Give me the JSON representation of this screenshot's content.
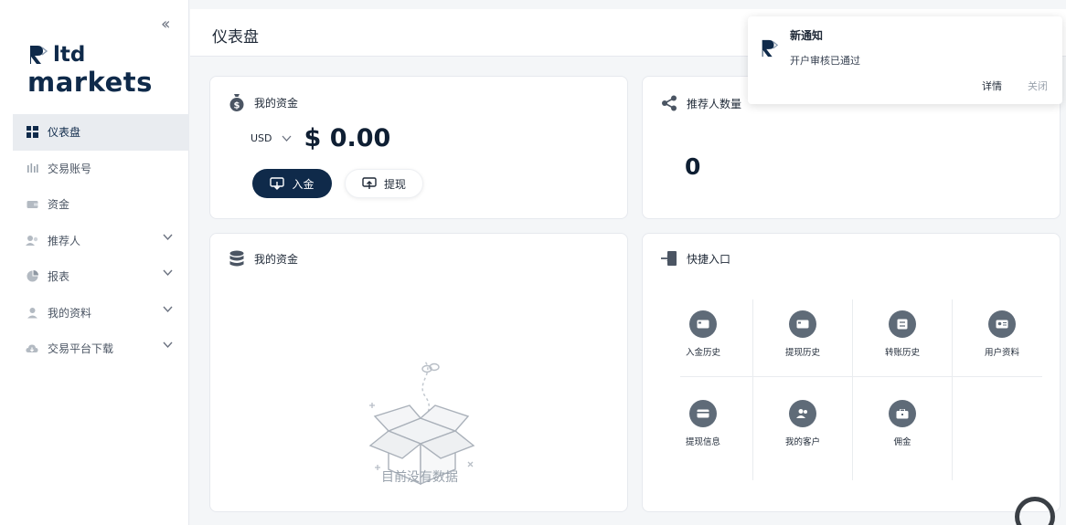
{
  "app": {
    "logo_line1": "ltd",
    "logo_line2": "markets",
    "brand_color": "#0f2a4a"
  },
  "sidebar": {
    "collapse_icon": "double-chevron-left-icon",
    "items": [
      {
        "label": "仪表盘",
        "icon": "dashboard-grid-icon",
        "active": true,
        "has_submenu": false
      },
      {
        "label": "交易账号",
        "icon": "trading-account-icon",
        "active": false,
        "has_submenu": false
      },
      {
        "label": "资金",
        "icon": "wallet-icon",
        "active": false,
        "has_submenu": false
      },
      {
        "label": "推荐人",
        "icon": "referrer-icon",
        "active": false,
        "has_submenu": true
      },
      {
        "label": "报表",
        "icon": "pie-chart-icon",
        "active": false,
        "has_submenu": true
      },
      {
        "label": "我的资料",
        "icon": "user-profile-icon",
        "active": false,
        "has_submenu": true
      },
      {
        "label": "交易平台下载",
        "icon": "cloud-download-icon",
        "active": false,
        "has_submenu": true
      }
    ]
  },
  "header": {
    "title": "仪表盘"
  },
  "funds_card": {
    "title": "我的资金",
    "currency": "USD",
    "amount": "$ 0.00",
    "deposit_label": "入金",
    "withdraw_label": "提现"
  },
  "referrals_card": {
    "title": "推荐人数量",
    "count": "0"
  },
  "funds_empty_card": {
    "title": "我的资金",
    "empty_text": "目前没有数据"
  },
  "quick_entry": {
    "title": "快捷入口",
    "items": [
      {
        "label": "入金历史",
        "icon": "deposit-history-icon"
      },
      {
        "label": "提现历史",
        "icon": "withdraw-history-icon"
      },
      {
        "label": "转账历史",
        "icon": "transfer-history-icon"
      },
      {
        "label": "用户资料",
        "icon": "user-info-icon"
      },
      {
        "label": "提现信息",
        "icon": "withdraw-info-icon"
      },
      {
        "label": "我的客户",
        "icon": "my-clients-icon"
      },
      {
        "label": "佣金",
        "icon": "commission-icon"
      }
    ]
  },
  "notification": {
    "title": "新通知",
    "body": "开户审核已通过",
    "detail_label": "详情",
    "close_label": "关闭"
  }
}
